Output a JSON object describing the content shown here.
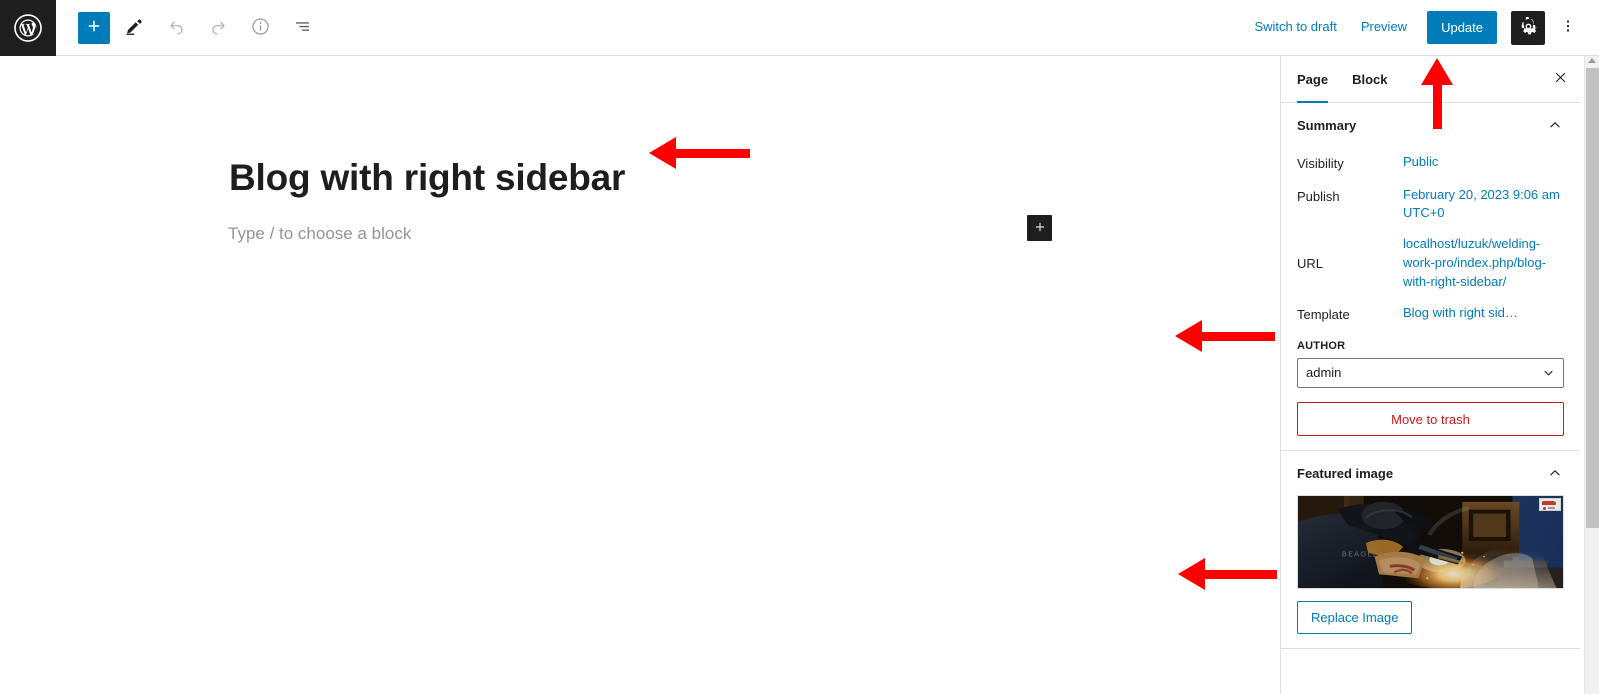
{
  "app": {
    "name": "WordPress Block Editor"
  },
  "topbar": {
    "logo_icon": "wordpress-logo-icon",
    "tools": [
      {
        "name": "add-block-button",
        "icon": "plus-icon",
        "label": "Toggle block inserter",
        "state": "active"
      },
      {
        "name": "edit-tool-button",
        "icon": "pencil-icon",
        "label": "Edit",
        "state": "enabled"
      },
      {
        "name": "undo-button",
        "icon": "undo-arrow-icon",
        "label": "Undo",
        "state": "disabled"
      },
      {
        "name": "redo-button",
        "icon": "redo-arrow-icon",
        "label": "Redo",
        "state": "disabled"
      },
      {
        "name": "details-button",
        "icon": "info-icon",
        "label": "Details",
        "state": "enabled"
      },
      {
        "name": "list-view-button",
        "icon": "list-view-icon",
        "label": "List View",
        "state": "enabled"
      }
    ],
    "switch_to_draft_label": "Switch to draft",
    "preview_label": "Preview",
    "update_label": "Update",
    "settings_icon": "gear-icon",
    "more_icon": "more-vertical-icon",
    "accent_color": "#007cba",
    "dark_color": "#1e1e1e"
  },
  "canvas": {
    "post_title": "Blog with right sidebar",
    "block_placeholder": "Type / to choose a block",
    "inline_inserter_icon": "plus-icon"
  },
  "sidebar": {
    "tabs": [
      {
        "label": "Page",
        "name": "tab-page",
        "active": true
      },
      {
        "label": "Block",
        "name": "tab-block",
        "active": false
      }
    ],
    "close_icon": "close-icon",
    "summary": {
      "title": "Summary",
      "chevron_icon": "chevron-up-icon",
      "rows": [
        {
          "label": "Visibility",
          "value": "Public",
          "name": "visibility-row"
        },
        {
          "label": "Publish",
          "value": "February 20, 2023 9:06 am UTC+0",
          "name": "publish-row"
        },
        {
          "label": "URL",
          "value": "localhost/luzuk/welding-work-pro/index.php/blog-with-right-sidebar/",
          "name": "url-row"
        },
        {
          "label": "Template",
          "value": "Blog with right sid…",
          "name": "template-row"
        }
      ],
      "author_label": "AUTHOR",
      "author_value": "admin",
      "author_chevron_icon": "chevron-down-icon",
      "trash_label": "Move to trash",
      "trash_color": "#cc1818"
    },
    "featured_image": {
      "title": "Featured image",
      "chevron_icon": "chevron-up-icon",
      "image_alt": "Welder working on metal with sparks and smoke",
      "replace_label": "Replace Image"
    }
  },
  "scrollbar": {
    "name": "sidebar-scrollbar",
    "arrow_icon": "scroll-up-arrow-icon"
  },
  "annotations": [
    {
      "name": "annotation-arrow-title",
      "direction": "left",
      "color": "#fe0000"
    },
    {
      "name": "annotation-arrow-update",
      "direction": "up",
      "color": "#fe0000"
    },
    {
      "name": "annotation-arrow-template",
      "direction": "left",
      "color": "#fe0000"
    },
    {
      "name": "annotation-arrow-featured-image",
      "direction": "left",
      "color": "#fe0000"
    }
  ]
}
